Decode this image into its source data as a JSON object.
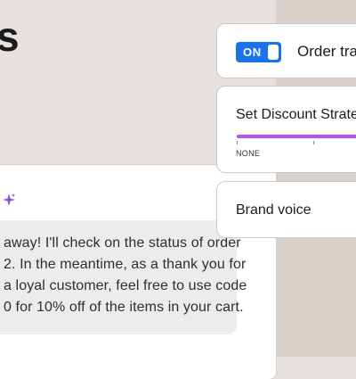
{
  "header": {
    "title_fragment": "s"
  },
  "chat": {
    "assistant_icon": "sparkle-icon",
    "message_lines": [
      "away! I'll check on the status of order",
      "2. In the meantime, as a thank you for",
      "a loyal customer, feel free to use code",
      "0 for 10% off of the items in your cart."
    ]
  },
  "panels": {
    "order_tracking": {
      "toggle_label": "ON",
      "toggle_on": true,
      "label": "Order trac"
    },
    "discount": {
      "title": "Set Discount Strate",
      "slider_min_label": "NONE"
    },
    "brand_voice": {
      "label": "Brand voice"
    }
  },
  "colors": {
    "toggle_on": "#1a73e8",
    "slider_track": "#b94ff0",
    "sparkle": "#8a4fe0",
    "background": "#e7e1dd"
  }
}
